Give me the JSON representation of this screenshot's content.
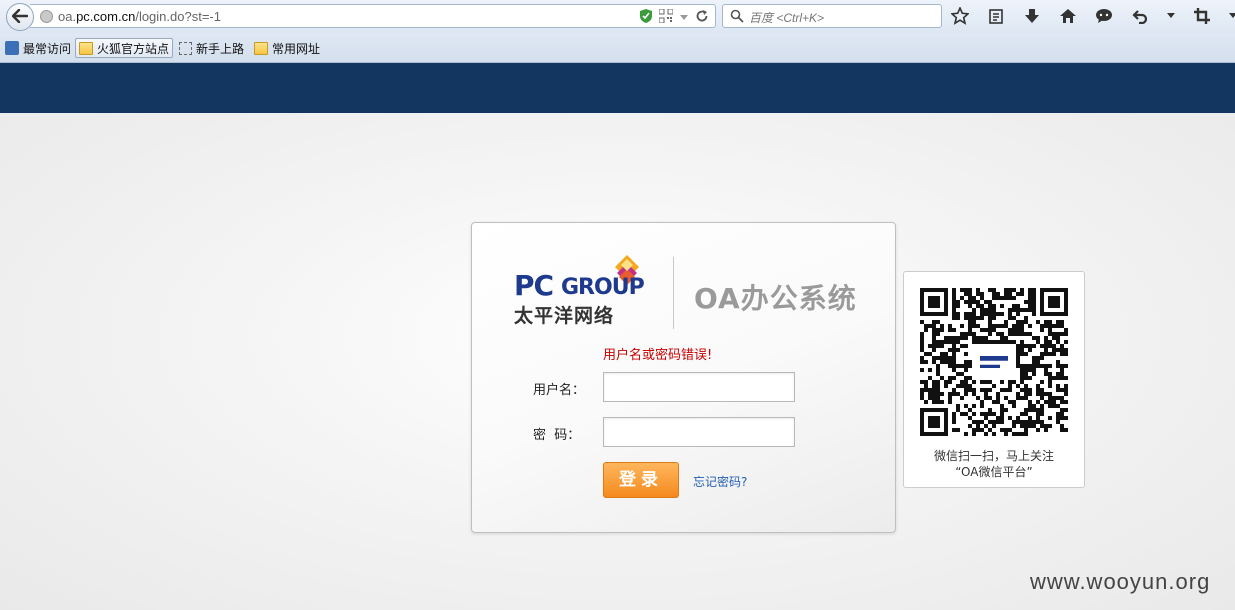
{
  "browser": {
    "url_prefix": "oa.",
    "url_host": "pc.com.cn",
    "url_path": "/login.do?st=-1",
    "search_placeholder": "百度 <Ctrl+K>",
    "bookmarks": [
      {
        "label": "最常访问"
      },
      {
        "label": "火狐官方站点"
      },
      {
        "label": "新手上路"
      },
      {
        "label": "常用网址"
      }
    ]
  },
  "login": {
    "logo_pc": "PC",
    "logo_group": "GROUP",
    "logo_cn": "太平洋网络",
    "system_title": "OA办公系统",
    "error_message": "用户名或密码错误!",
    "username_label": "用户名：",
    "password_label": "密  码：",
    "username_value": "",
    "password_value": "",
    "login_button": "登录",
    "forgot_link": "忘记密码?"
  },
  "qr": {
    "caption_line1": "微信扫一扫，马上关注",
    "caption_line2": "“OA微信平台”"
  },
  "watermark": "www.wooyun.org",
  "colors": {
    "header_band": "#12365f",
    "error": "#c80000",
    "button": "#f48a1e",
    "link": "#245fb0"
  }
}
